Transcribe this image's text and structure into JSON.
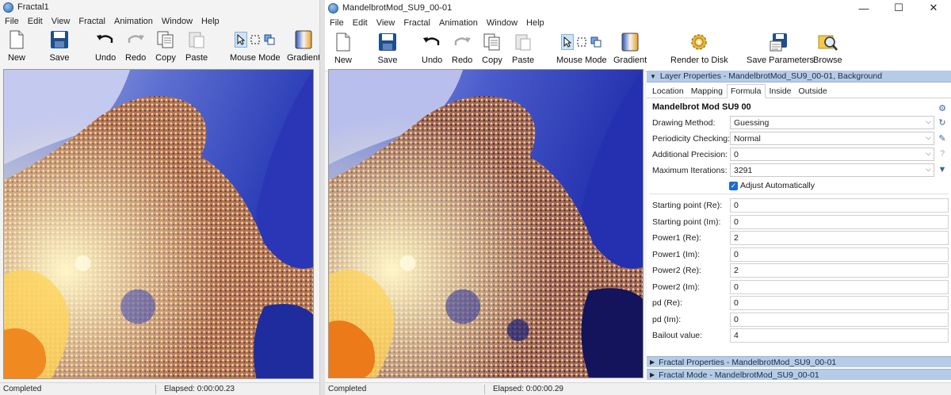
{
  "left_window": {
    "title": "Fractal1",
    "menu": [
      "File",
      "Edit",
      "View",
      "Fractal",
      "Animation",
      "Window",
      "Help"
    ],
    "toolbar": [
      {
        "label": "New",
        "icon": "new-file-icon"
      },
      {
        "label": "Save",
        "icon": "save-icon"
      },
      {
        "label": "Undo",
        "icon": "undo-icon"
      },
      {
        "label": "Redo",
        "icon": "redo-icon"
      },
      {
        "label": "Copy",
        "icon": "copy-icon"
      },
      {
        "label": "Paste",
        "icon": "paste-icon"
      },
      {
        "label": "Mouse Mode",
        "icon": "mouse-mode-icon"
      },
      {
        "label": "Gradient",
        "icon": "gradient-icon"
      }
    ],
    "status": {
      "state": "Completed",
      "elapsed": "Elapsed: 0:00:00.23"
    }
  },
  "right_window": {
    "title": "MandelbrotMod_SU9_00-01",
    "window_controls": {
      "minimize": "—",
      "maximize": "☐",
      "close": "✕"
    },
    "menu": [
      "File",
      "Edit",
      "View",
      "Fractal",
      "Animation",
      "Window",
      "Help"
    ],
    "toolbar": [
      {
        "label": "New",
        "icon": "new-file-icon"
      },
      {
        "label": "Save",
        "icon": "save-icon"
      },
      {
        "label": "Undo",
        "icon": "undo-icon"
      },
      {
        "label": "Redo",
        "icon": "redo-icon"
      },
      {
        "label": "Copy",
        "icon": "copy-icon"
      },
      {
        "label": "Paste",
        "icon": "paste-icon"
      },
      {
        "label": "Mouse Mode",
        "icon": "mouse-mode-icon"
      },
      {
        "label": "Gradient",
        "icon": "gradient-icon"
      },
      {
        "label": "Render to Disk",
        "icon": "gear-icon"
      },
      {
        "label": "Save Parameters",
        "icon": "save-parameters-icon"
      },
      {
        "label": "Browse",
        "icon": "browse-icon"
      }
    ],
    "status": {
      "state": "Completed",
      "elapsed": "Elapsed: 0:00:00.29"
    }
  },
  "panel": {
    "header": "Layer Properties - MandelbrotMod_SU9_00-01, Background",
    "tabs": [
      "Location",
      "Mapping",
      "Formula",
      "Inside",
      "Outside"
    ],
    "active_tab": "Formula",
    "formula_name": "Mandelbrot Mod SU9 00",
    "settings": [
      {
        "label": "Drawing Method:",
        "value": "Guessing",
        "dropdown": true
      },
      {
        "label": "Periodicity Checking:",
        "value": "Normal",
        "dropdown": true
      },
      {
        "label": "Additional Precision:",
        "value": "0",
        "dropdown": true
      },
      {
        "label": "Maximum Iterations:",
        "value": "3291",
        "dropdown": true
      }
    ],
    "adjust_automatically": {
      "label": "Adjust Automatically",
      "checked": true
    },
    "params": [
      {
        "label": "Starting point (Re):",
        "value": "0"
      },
      {
        "label": "Starting point (Im):",
        "value": "0"
      },
      {
        "label": "Power1 (Re):",
        "value": "2"
      },
      {
        "label": "Power1 (Im):",
        "value": "0"
      },
      {
        "label": "Power2 (Re):",
        "value": "2"
      },
      {
        "label": "Power2 (Im):",
        "value": "0"
      },
      {
        "label": "pd (Re):",
        "value": "0"
      },
      {
        "label": "pd (Im):",
        "value": "0"
      },
      {
        "label": "Bailout value:",
        "value": "4"
      }
    ],
    "collapsed_sections": [
      "Fractal Properties - MandelbrotMod_SU9_00-01",
      "Fractal Mode - MandelbrotMod_SU9_00-01"
    ]
  }
}
